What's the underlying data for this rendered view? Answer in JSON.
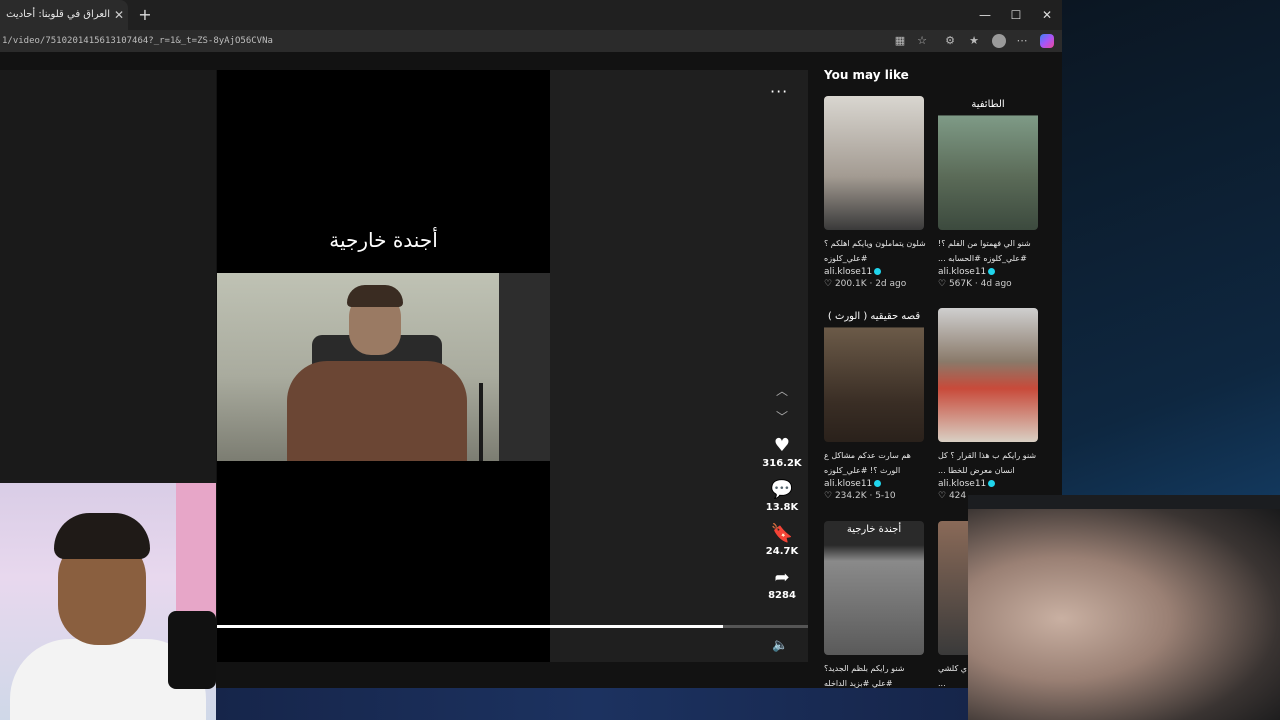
{
  "browser": {
    "tab_title": "العراق في قلوبنا: أحاديث عن الحقيقة",
    "tab_close": "✕",
    "new_tab": "+",
    "window_controls": {
      "minimize": "—",
      "maximize": "☐",
      "close": "✕"
    },
    "url": "1/video/7510201415613107464?_r=1&_t=ZS-8yAjO56CVNa"
  },
  "video": {
    "overlay_text": "أجندة خارجية",
    "more_label": "···",
    "progress_fraction": 0.857,
    "actions": {
      "likes": "316.2K",
      "comments": "13.8K",
      "saves": "24.7K",
      "shares": "8284"
    }
  },
  "sidebar": {
    "heading": "You may like",
    "cards": [
      {
        "thumb_title": "",
        "caption_line1": "شلون يتماملون ويايكم اهلكم ؟",
        "caption_line2": "#علي_كلوزه",
        "author": "ali.klose11",
        "likes": "200.1K",
        "age": "2d ago"
      },
      {
        "thumb_title": "الطائفية",
        "caption_line1": "شنو الي فهمتوا من الفلم ؟!",
        "caption_line2": "#علي_كلوزه #الحسابه ...",
        "author": "ali.klose11",
        "likes": "567K",
        "age": "4d ago"
      },
      {
        "thumb_title": "قصه حقيقيه ( الورث )",
        "caption_line1": "هم سارت عدكم مشاكل ع",
        "caption_line2": "الورث ؟! #علي_كلوزه",
        "author": "ali.klose11",
        "likes": "234.2K",
        "age": "5-10"
      },
      {
        "thumb_title": "",
        "caption_line1": "شنو رايكم ب هذا القرار ؟ كل",
        "caption_line2": "انسان معرض للخطا ...",
        "author": "ali.klose11",
        "likes": "424",
        "age": ""
      },
      {
        "thumb_title": "أجندة خارجية",
        "caption_line1": "شنو رايكم بلظم الجديد؟",
        "caption_line2": "#علي #بزيد الداخله",
        "author": "",
        "likes": "",
        "age": ""
      },
      {
        "thumb_title": "",
        "caption_line1": "ي كلشي",
        "caption_line2": "...",
        "author": "",
        "likes": "",
        "age": ""
      }
    ]
  }
}
